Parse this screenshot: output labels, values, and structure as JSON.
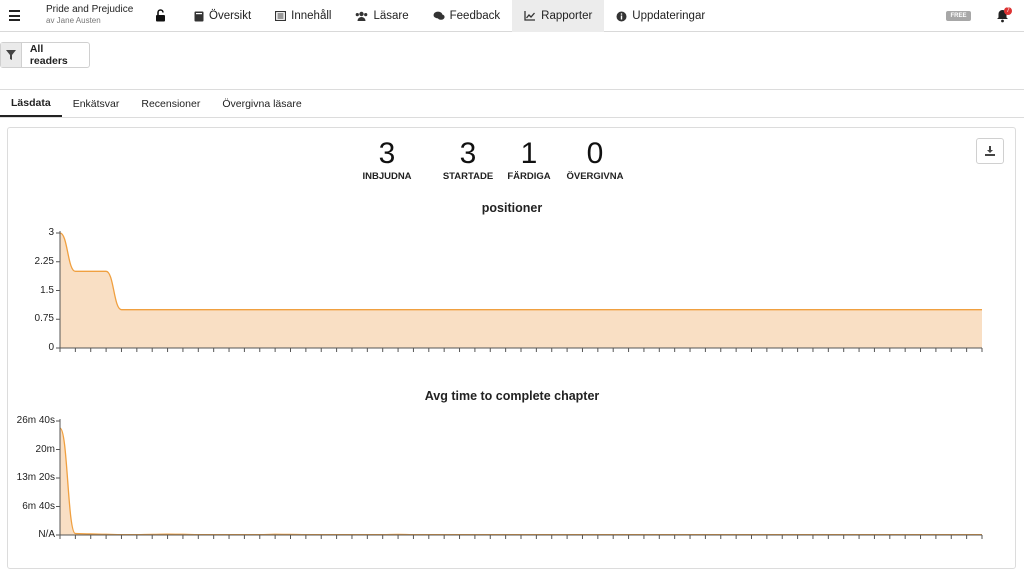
{
  "header": {
    "book_title": "Pride and Prejudice",
    "book_author": "av Jane Austen",
    "nav": [
      {
        "label": "Översikt",
        "icon": "book-icon"
      },
      {
        "label": "Innehåll",
        "icon": "list-icon"
      },
      {
        "label": "Läsare",
        "icon": "users-icon"
      },
      {
        "label": "Feedback",
        "icon": "comments-icon"
      },
      {
        "label": "Rapporter",
        "icon": "chart-line-icon",
        "active": true
      },
      {
        "label": "Uppdateringar",
        "icon": "info-circle-icon"
      }
    ],
    "plan_badge": "FREE",
    "notification_count": "7"
  },
  "filter": {
    "label": "All readers"
  },
  "tabs": [
    "Läsdata",
    "Enkätsvar",
    "Recensioner",
    "Övergivna läsare"
  ],
  "stats": [
    {
      "value": "3",
      "label": "INBJUDNA"
    },
    {
      "value": "3",
      "label": "STARTADE"
    },
    {
      "value": "1",
      "label": "FÄRDIGA"
    },
    {
      "value": "0",
      "label": "ÖVERGIVNA"
    }
  ],
  "colors": {
    "accent": "#f0a040",
    "fill": "#f9dfc4",
    "active_tab_bg": "#ececec"
  },
  "chart_data": [
    {
      "type": "area",
      "title": "positioner",
      "xlabel": "",
      "ylabel": "",
      "ylim": [
        0,
        3
      ],
      "yticks": [
        "0",
        "0.75",
        "1.5",
        "2.25",
        "3"
      ],
      "x_tick_count": 61,
      "values": [
        3,
        2,
        2,
        2,
        1,
        1,
        1,
        1,
        1,
        1,
        1,
        1,
        1,
        1,
        1,
        1,
        1,
        1,
        1,
        1,
        1,
        1,
        1,
        1,
        1,
        1,
        1,
        1,
        1,
        1,
        1,
        1,
        1,
        1,
        1,
        1,
        1,
        1,
        1,
        1,
        1,
        1,
        1,
        1,
        1,
        1,
        1,
        1,
        1,
        1,
        1,
        1,
        1,
        1,
        1,
        1,
        1,
        1,
        1,
        1,
        1
      ]
    },
    {
      "type": "area",
      "title": "Avg time to complete chapter",
      "xlabel": "",
      "ylabel": "",
      "ylim": [
        0,
        1600
      ],
      "yticks": [
        "N/A",
        "6m 40s",
        "13m 20s",
        "20m",
        "26m 40s"
      ],
      "x_tick_count": 61,
      "values": [
        1500,
        20,
        15,
        10,
        5,
        5,
        8,
        12,
        10,
        5,
        5,
        5,
        5,
        5,
        10,
        8,
        5,
        5,
        5,
        5,
        5,
        5,
        8,
        5,
        5,
        5,
        5,
        5,
        5,
        5,
        5,
        5,
        5,
        5,
        5,
        5,
        5,
        5,
        5,
        5,
        5,
        5,
        5,
        5,
        5,
        5,
        5,
        5,
        5,
        5,
        5,
        5,
        5,
        5,
        5,
        5,
        5,
        5,
        5,
        5,
        5
      ]
    }
  ]
}
